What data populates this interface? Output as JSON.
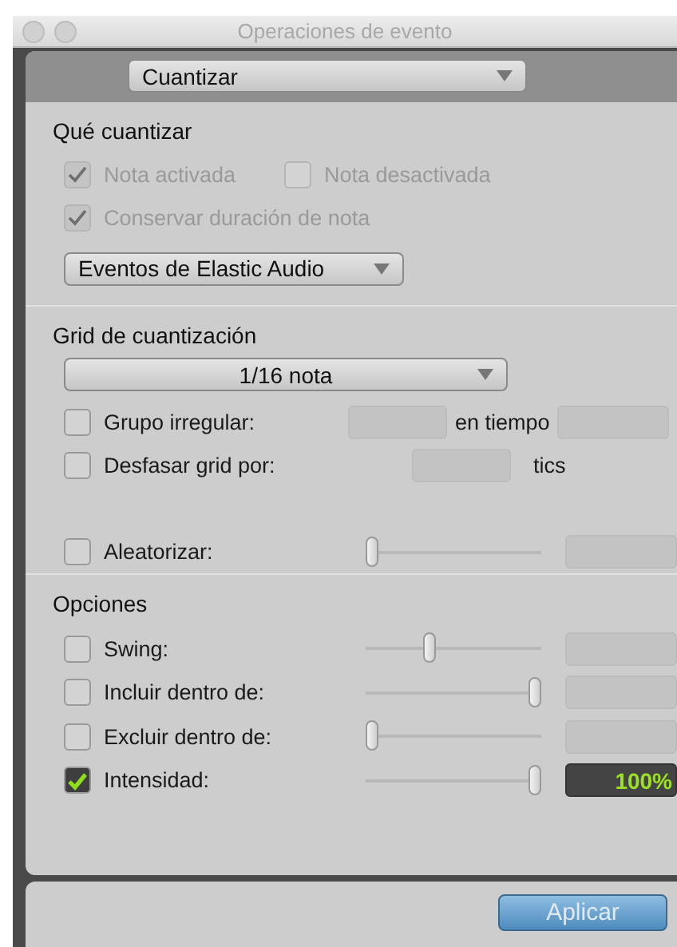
{
  "window": {
    "title": "Operaciones de evento"
  },
  "operation_menu": {
    "value": "Cuantizar"
  },
  "what_to_quantize": {
    "title": "Qué cuantizar",
    "checkboxes": [
      {
        "label": "Nota activada",
        "checked": true,
        "disabled": true
      },
      {
        "label": "Nota desactivada",
        "checked": false,
        "disabled": true
      },
      {
        "label": "Conservar duración de nota",
        "checked": true,
        "disabled": true
      }
    ],
    "event_menu": {
      "value": "Eventos de Elastic Audio"
    }
  },
  "grid": {
    "title": "Grid de cuantización",
    "menu": {
      "value": "1/16 nota"
    },
    "irregular": {
      "label": "Grupo irregular:",
      "checked": false,
      "between": "en tiempo"
    },
    "offset": {
      "label": "Desfasar grid por:",
      "checked": false,
      "unit": "tics"
    },
    "randomize": {
      "label": "Aleatorizar:",
      "checked": false,
      "level": 0
    }
  },
  "options": {
    "title": "Opciones",
    "rows": [
      {
        "label": "Swing:",
        "checked": false,
        "level": 0.35
      },
      {
        "label": "Incluir dentro de:",
        "checked": false,
        "level": 1
      },
      {
        "label": "Excluir dentro de:",
        "checked": false,
        "level": 0
      },
      {
        "label": "Intensidad:",
        "checked": true,
        "level": 1,
        "value": "100%"
      }
    ]
  },
  "apply_button": "Aplicar"
}
